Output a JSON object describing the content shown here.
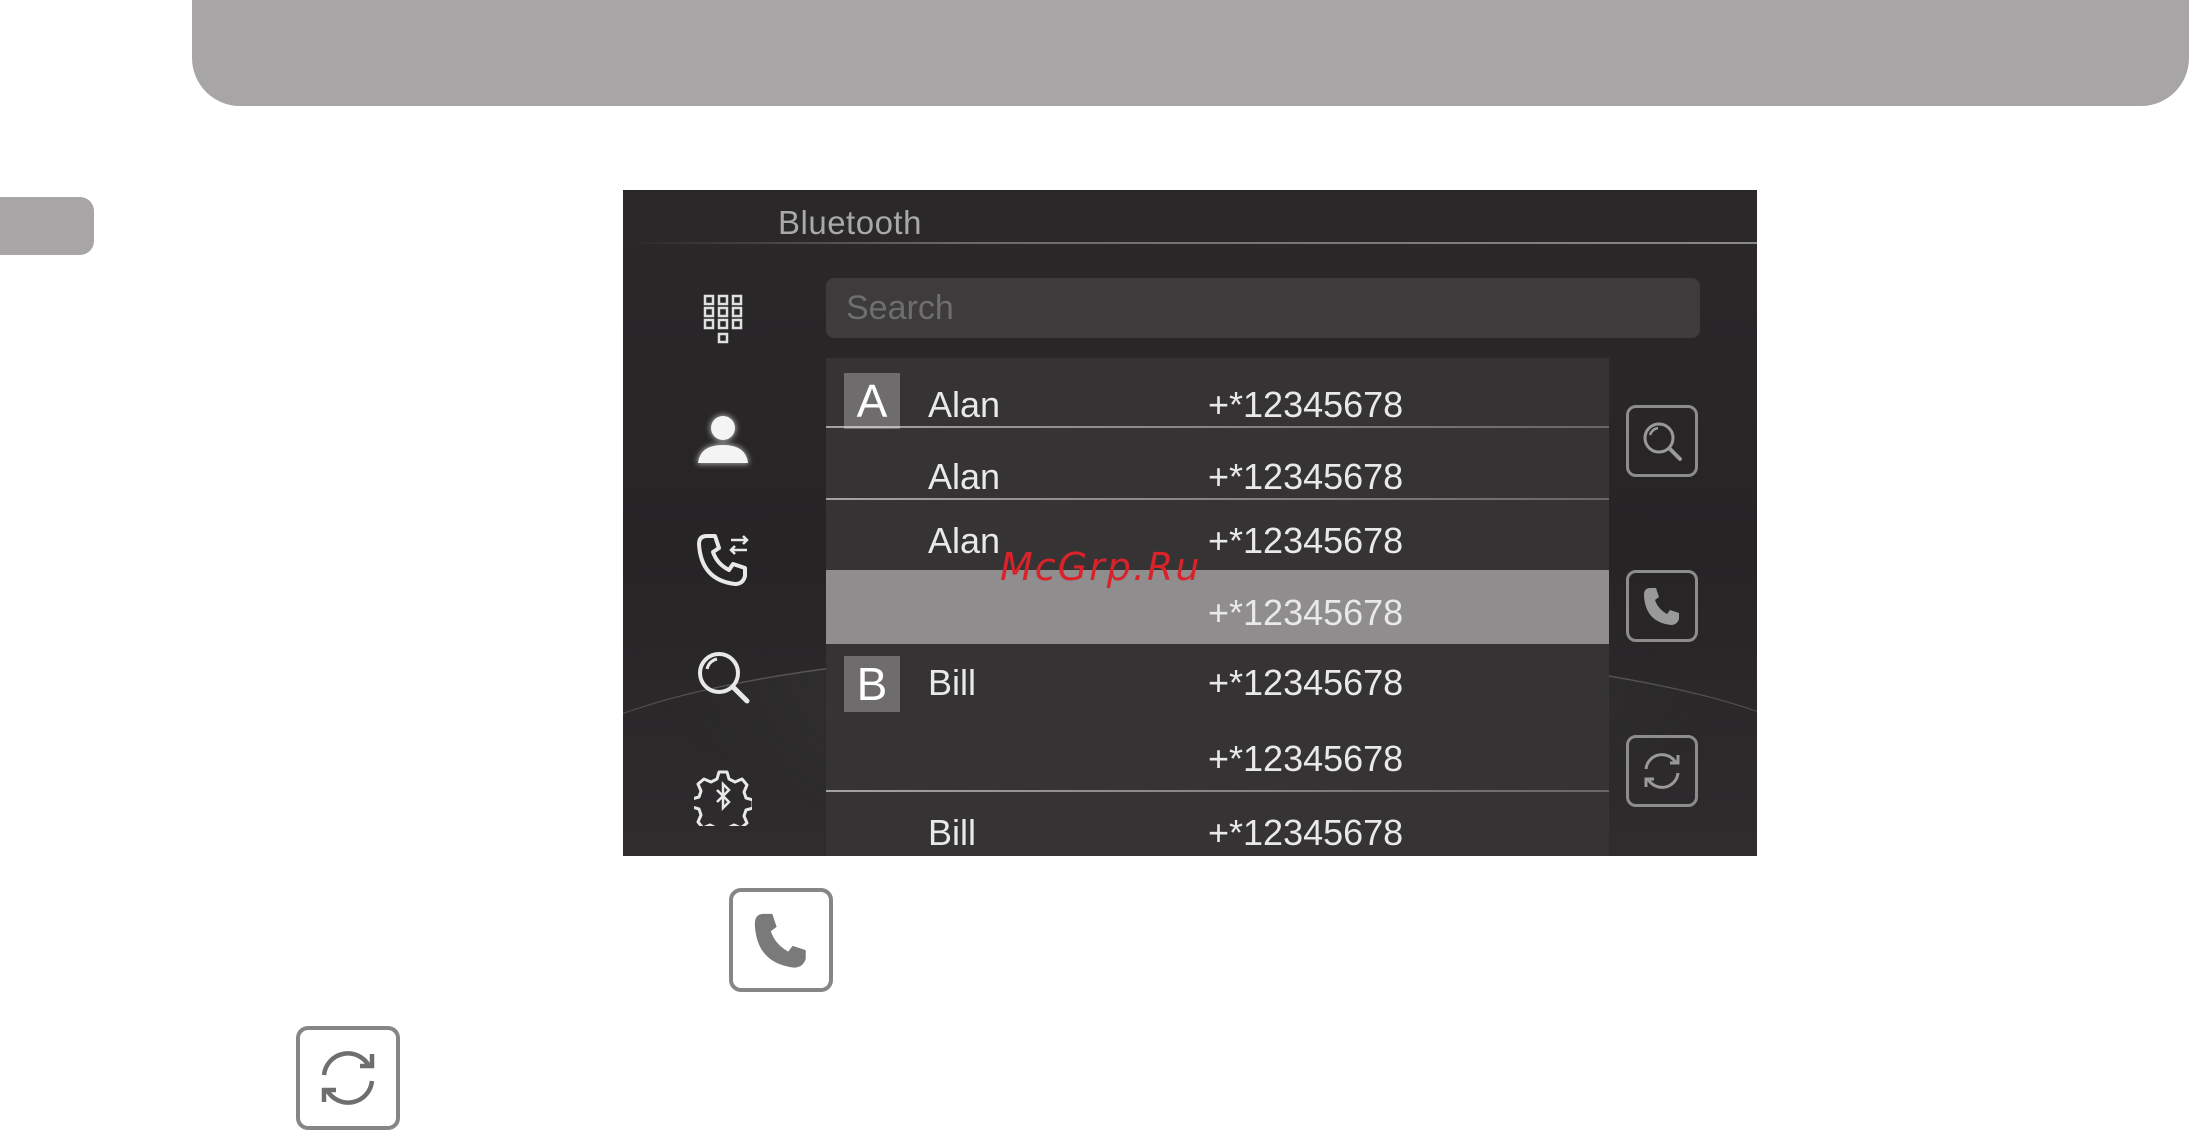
{
  "app": {
    "title": "Bluetooth"
  },
  "search": {
    "placeholder": "Search"
  },
  "nav": {
    "items": [
      {
        "icon": "dialpad-icon"
      },
      {
        "icon": "contacts-icon",
        "active": true
      },
      {
        "icon": "call-history-icon"
      },
      {
        "icon": "search-icon"
      },
      {
        "icon": "bluetooth-settings-icon"
      }
    ]
  },
  "contacts": [
    {
      "letter": "A",
      "name": "Alan",
      "number": "+*12345678"
    },
    {
      "letter": "",
      "name": "Alan",
      "number": "+*12345678"
    },
    {
      "letter": "",
      "name": "Alan",
      "number": "+*12345678"
    },
    {
      "letter": "",
      "name": "",
      "number": "+*12345678",
      "selected": true
    },
    {
      "letter": "B",
      "name": "Bill",
      "number": "+*12345678"
    },
    {
      "letter": "",
      "name": "",
      "number": "+*12345678"
    },
    {
      "letter": "",
      "name": "Bill",
      "number": "+*12345678"
    }
  ],
  "actions": {
    "search": {
      "icon": "search-icon"
    },
    "call": {
      "icon": "phone-icon"
    },
    "sync": {
      "icon": "sync-icon"
    }
  },
  "watermark": "McGrp.Ru",
  "colors": {
    "screen_bg": "#282627",
    "list_bg": "#353334",
    "selected_row": "#8f8d8e",
    "watermark": "#d8232a"
  }
}
